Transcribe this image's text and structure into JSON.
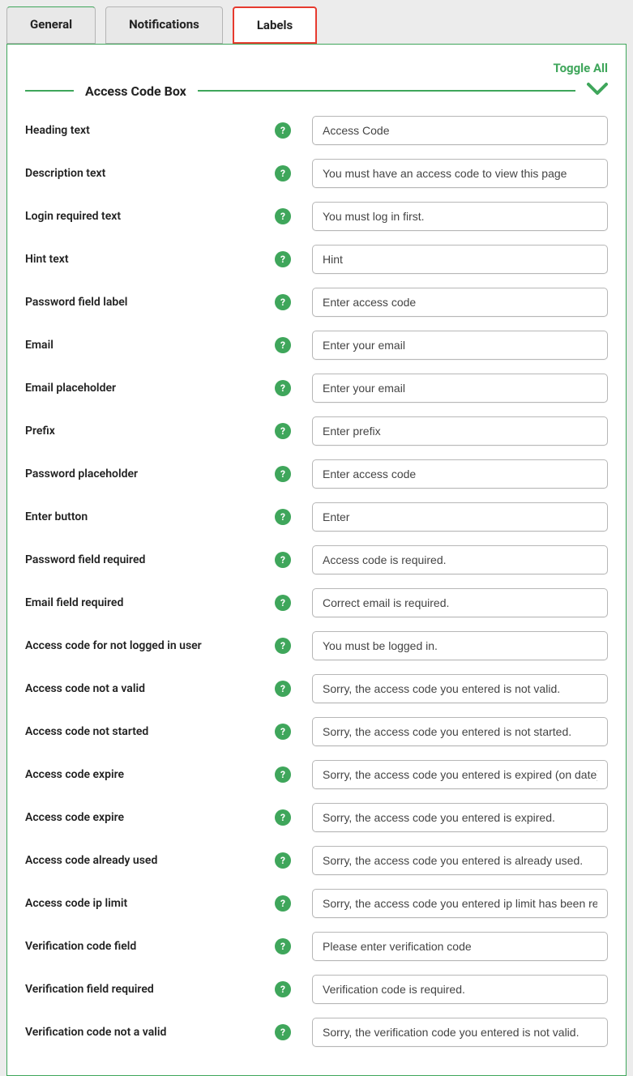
{
  "tabs": {
    "general": "General",
    "notifications": "Notifications",
    "labels": "Labels"
  },
  "toggle_all": "Toggle All",
  "section": {
    "title": "Access Code Box"
  },
  "fields": [
    {
      "label": "Heading text",
      "value": "Access Code"
    },
    {
      "label": "Description text",
      "value": "You must have an access code to view this page"
    },
    {
      "label": "Login required text",
      "value": "You must log in first."
    },
    {
      "label": "Hint text",
      "value": "Hint"
    },
    {
      "label": "Password field label",
      "value": "Enter access code"
    },
    {
      "label": "Email",
      "value": "Enter your email"
    },
    {
      "label": "Email placeholder",
      "value": "Enter your email"
    },
    {
      "label": "Prefix",
      "value": "Enter prefix"
    },
    {
      "label": "Password placeholder",
      "value": "Enter access code"
    },
    {
      "label": "Enter button",
      "value": "Enter"
    },
    {
      "label": "Password field required",
      "value": "Access code is required."
    },
    {
      "label": "Email field required",
      "value": "Correct email is required."
    },
    {
      "label": "Access code for not logged in user",
      "value": "You must be logged in."
    },
    {
      "label": "Access code not a valid",
      "value": "Sorry, the access code you entered is not valid."
    },
    {
      "label": "Access code not started",
      "value": "Sorry, the access code you entered is not started."
    },
    {
      "label": "Access code expire",
      "value": "Sorry, the access code you entered is expired (on date)."
    },
    {
      "label": "Access code expire",
      "value": "Sorry, the access code you entered is expired."
    },
    {
      "label": "Access code already used",
      "value": "Sorry, the access code you entered is already used."
    },
    {
      "label": "Access code ip limit",
      "value": "Sorry, the access code you entered ip limit has been reached."
    },
    {
      "label": "Verification code field",
      "value": "Please enter verification code"
    },
    {
      "label": "Verification field required",
      "value": "Verification code is required."
    },
    {
      "label": "Verification code not a valid",
      "value": "Sorry, the verification code you entered is not valid."
    }
  ]
}
